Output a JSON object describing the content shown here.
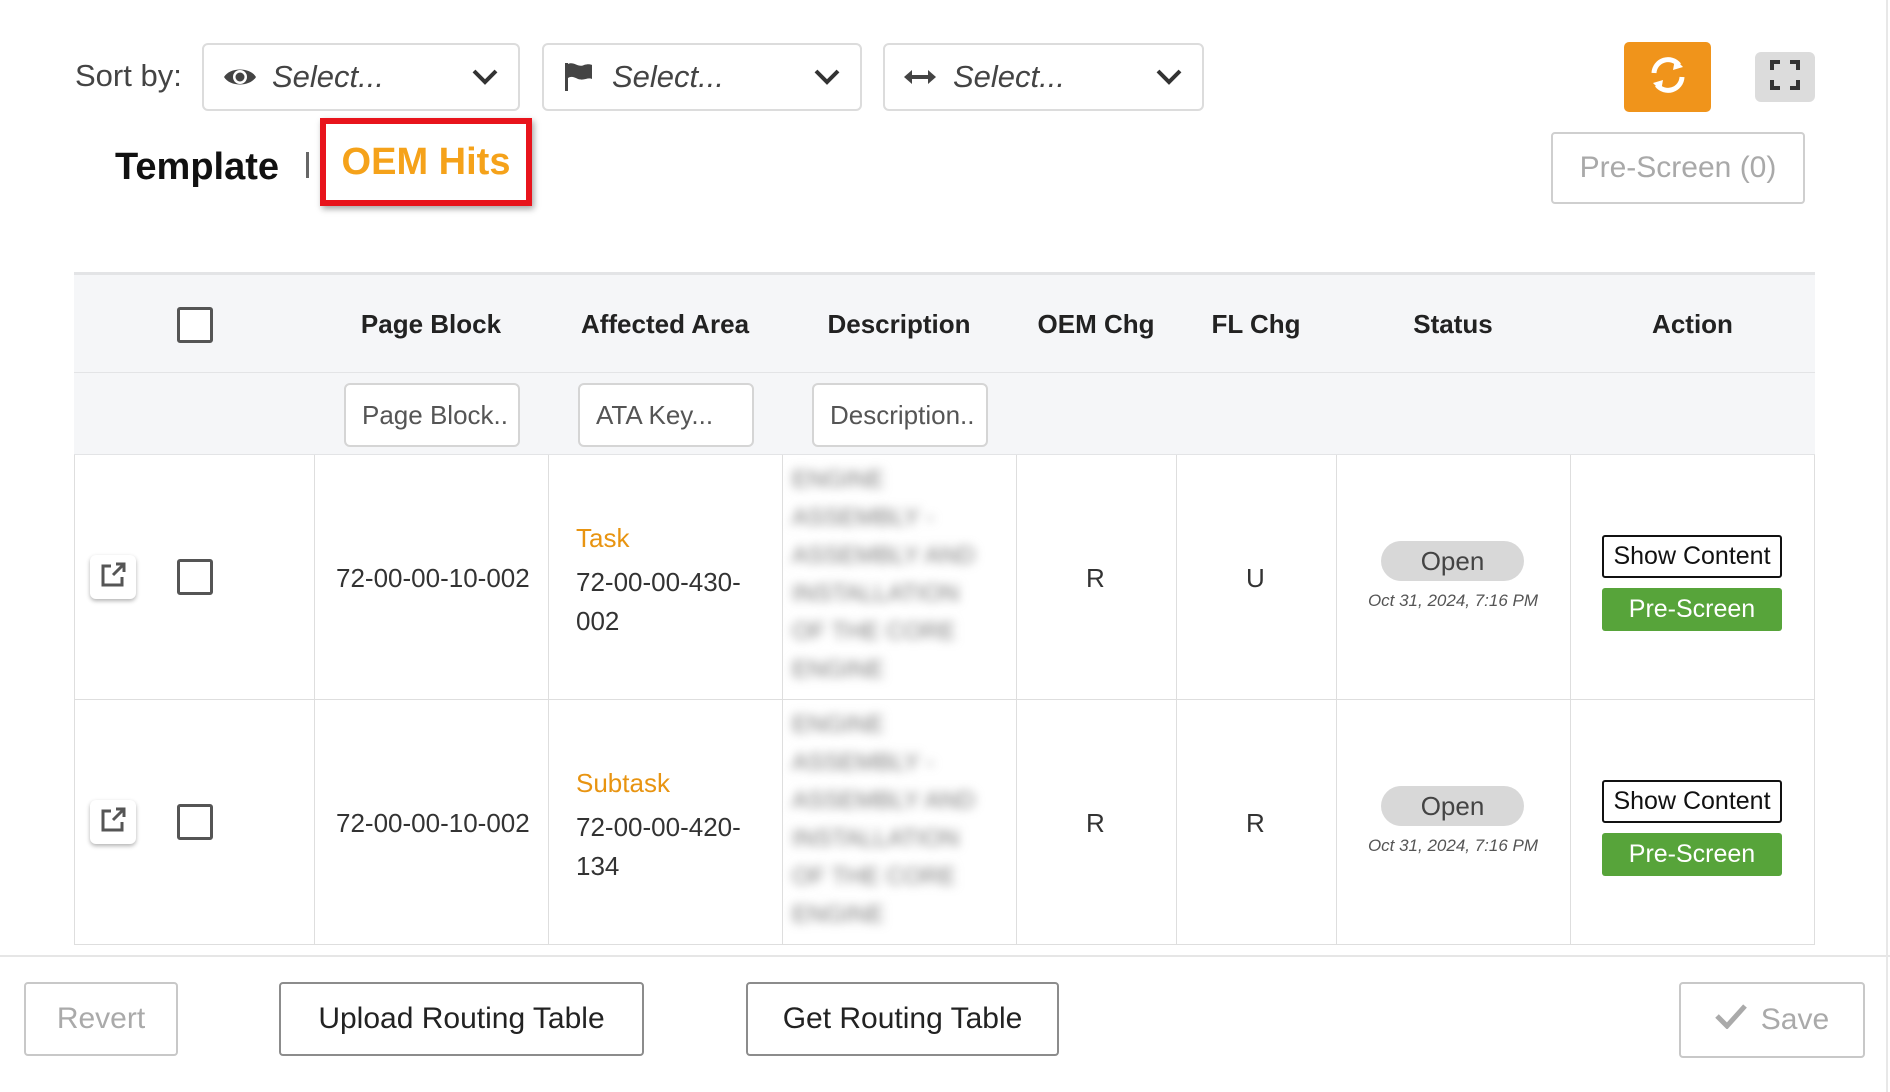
{
  "sort": {
    "label": "Sort by:",
    "selects": [
      {
        "icon": "eye-icon",
        "placeholder": "Select..."
      },
      {
        "icon": "flag-icon",
        "placeholder": "Select..."
      },
      {
        "icon": "arrows-horizontal-icon",
        "placeholder": "Select..."
      }
    ]
  },
  "toolbar": {
    "refresh_icon": "refresh-icon",
    "expand_icon": "expand-icon",
    "accent_color": "#f0941b"
  },
  "tabs": {
    "template": "Template",
    "oem_hits": "OEM Hits",
    "active_color": "#f5a21a"
  },
  "prescreen_top": "Pre-Screen (0)",
  "table": {
    "columns": [
      "Page Block",
      "Affected Area",
      "Description",
      "OEM Chg",
      "FL Chg",
      "Status",
      "Action"
    ],
    "filters": {
      "page_block": "Page Block..",
      "ata_key": "ATA Key...",
      "description": "Description.."
    },
    "rows": [
      {
        "page_block": "72-00-00-10-002",
        "area_type": "Task",
        "area_key": "72-00-00-430-002",
        "description_lines": [
          "ENGINE",
          "ASSEMBLY -",
          "ASSEMBLY AND",
          "INSTALLATION",
          "OF THE CORE",
          "ENGINE"
        ],
        "oem_chg": "R",
        "fl_chg": "U",
        "status": "Open",
        "status_date": "Oct 31, 2024, 7:16 PM",
        "show_content": "Show Content",
        "pre_screen": "Pre-Screen"
      },
      {
        "page_block": "72-00-00-10-002",
        "area_type": "Subtask",
        "area_key": "72-00-00-420-134",
        "description_lines": [
          "ENGINE",
          "ASSEMBLY -",
          "ASSEMBLY AND",
          "INSTALLATION",
          "OF THE CORE",
          "ENGINE"
        ],
        "oem_chg": "R",
        "fl_chg": "R",
        "status": "Open",
        "status_date": "Oct 31, 2024, 7:16 PM",
        "show_content": "Show Content",
        "pre_screen": "Pre-Screen"
      }
    ]
  },
  "footer": {
    "revert": "Revert",
    "upload": "Upload Routing Table",
    "get": "Get Routing Table",
    "save": "Save"
  }
}
